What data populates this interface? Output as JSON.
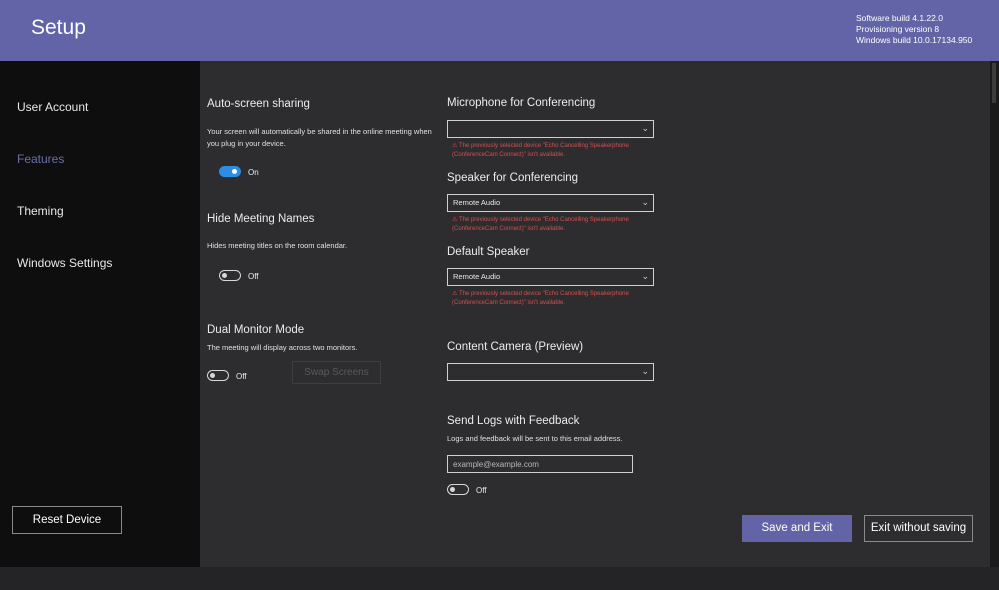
{
  "header": {
    "title": "Setup",
    "software_build": "Software build 4.1.22.0",
    "provisioning_version": "Provisioning version 8",
    "windows_build": "Windows build 10.0.17134.950"
  },
  "sidebar": {
    "items": [
      {
        "label": "User Account"
      },
      {
        "label": "Features",
        "active": true
      },
      {
        "label": "Theming"
      },
      {
        "label": "Windows Settings"
      }
    ],
    "reset_label": "Reset Device"
  },
  "features": {
    "auto_share": {
      "title": "Auto-screen sharing",
      "desc": "Your screen will automatically be shared in the online meeting when you plug in your device.",
      "state": "On"
    },
    "hide_names": {
      "title": "Hide Meeting Names",
      "desc": "Hides meeting titles on the room calendar.",
      "state": "Off"
    },
    "dual_monitor": {
      "title": "Dual Monitor Mode",
      "desc": "The meeting will display across two monitors.",
      "state": "Off",
      "swap_label": "Swap Screens"
    }
  },
  "audio": {
    "mic": {
      "title": "Microphone for Conferencing",
      "value": "",
      "warning": "⚠ The previously selected device \"Echo Cancelling Speakerphone (ConferenceCam Connect)\" isn't available."
    },
    "speaker": {
      "title": "Speaker for Conferencing",
      "value": "Remote Audio",
      "warning": "⚠ The previously selected device \"Echo Cancelling Speakerphone (ConferenceCam Connect)\" isn't available."
    },
    "default_speaker": {
      "title": "Default Speaker",
      "value": "Remote Audio",
      "warning": "⚠ The previously selected device \"Echo Cancelling Speakerphone (ConferenceCam Connect)\" isn't available."
    },
    "camera": {
      "title": "Content Camera (Preview)",
      "value": ""
    }
  },
  "logs": {
    "title": "Send Logs with Feedback",
    "desc": "Logs and feedback will be sent to this email address.",
    "placeholder": "example@example.com",
    "state": "Off"
  },
  "actions": {
    "save": "Save and Exit",
    "exit": "Exit without saving"
  },
  "colors": {
    "accent": "#6264a7",
    "toggle_on": "#2d8ce3",
    "warning": "#d3504f"
  },
  "icons": {
    "chevron": "chevron-down-icon",
    "warning": "warning-icon"
  }
}
